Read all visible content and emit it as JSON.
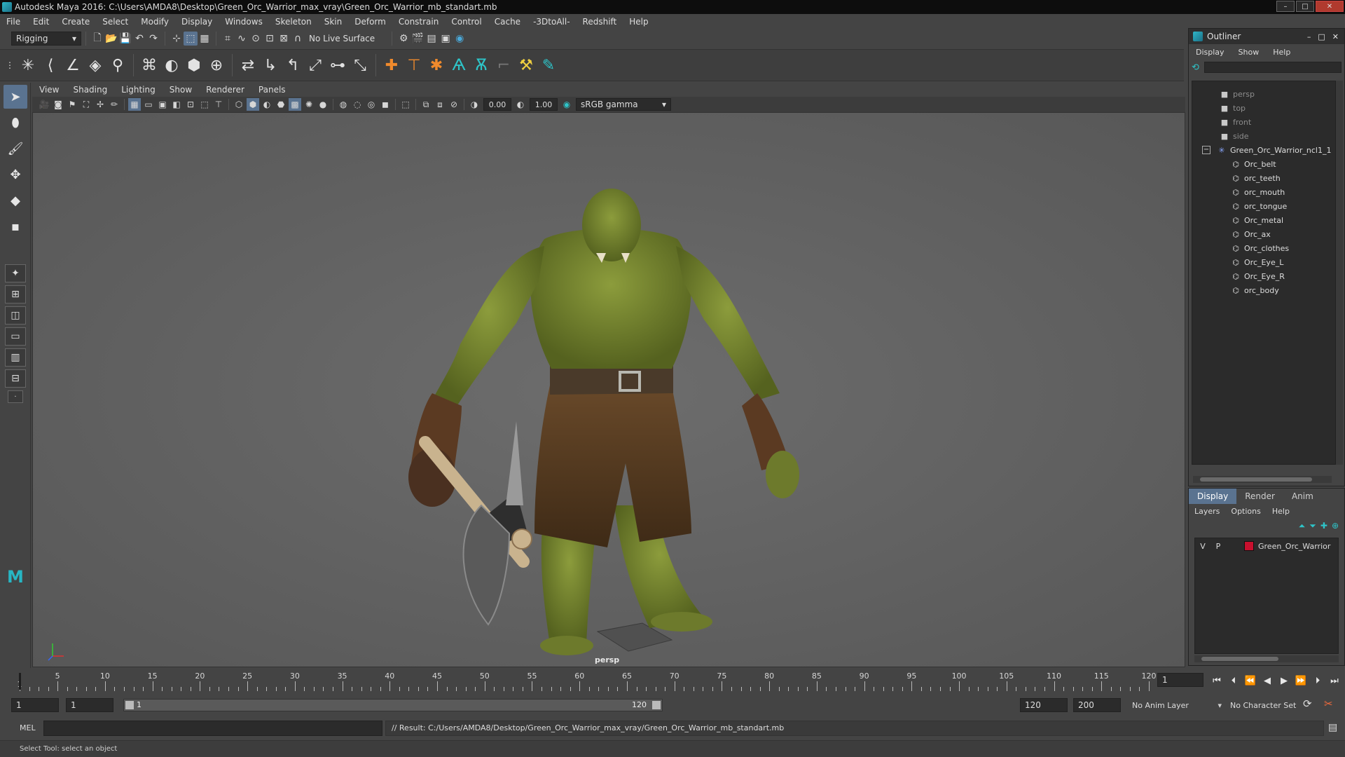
{
  "window": {
    "title": "Autodesk Maya 2016: C:\\Users\\AMDA8\\Desktop\\Green_Orc_Warrior_max_vray\\Green_Orc_Warrior_mb_standart.mb",
    "min": "–",
    "max": "□",
    "close": "✕"
  },
  "menubar": [
    "File",
    "Edit",
    "Create",
    "Select",
    "Modify",
    "Display",
    "Windows",
    "Skeleton",
    "Skin",
    "Deform",
    "Constrain",
    "Control",
    "Cache",
    "-3DtoAll-",
    "Redshift",
    "Help"
  ],
  "statusline": {
    "menuset": "Rigging",
    "live_surface": "No Live Surface"
  },
  "panel": {
    "menus": [
      "View",
      "Shading",
      "Lighting",
      "Show",
      "Renderer",
      "Panels"
    ],
    "exposure": "0.00",
    "gamma": "1.00",
    "colorspace": "sRGB gamma",
    "camera_label": "persp"
  },
  "timeline": {
    "ticks": [
      "5",
      "10",
      "15",
      "20",
      "25",
      "30",
      "35",
      "40",
      "45",
      "50",
      "55",
      "60",
      "65",
      "70",
      "75",
      "80",
      "85",
      "90",
      "95",
      "100",
      "105",
      "110",
      "115",
      "120"
    ],
    "first_label": "1",
    "end_label": "120",
    "current_frame": "1",
    "current_frame_value": 1,
    "min": 1,
    "max": 120
  },
  "range": {
    "start": "1",
    "playback_start": "1",
    "slider_start": "1",
    "slider_end": "120",
    "playback_end": "120",
    "end": "200",
    "anim_layer": "No Anim Layer",
    "character_set": "No Character Set"
  },
  "cmdline": {
    "lang": "MEL",
    "result": "// Result: C:/Users/AMDA8/Desktop/Green_Orc_Warrior_max_vray/Green_Orc_Warrior_mb_standart.mb"
  },
  "helpline": "Select Tool: select an object",
  "outliner": {
    "title": "Outliner",
    "menus": [
      "Display",
      "Show",
      "Help"
    ],
    "cameras": [
      "persp",
      "top",
      "front",
      "side"
    ],
    "group": "Green_Orc_Warrior_ncl1_1",
    "children": [
      "Orc_belt",
      "orc_teeth",
      "orc_mouth",
      "orc_tongue",
      "Orc_metal",
      "Orc_ax",
      "Orc_clothes",
      "Orc_Eye_L",
      "Orc_Eye_R",
      "orc_body"
    ],
    "collapse": "−"
  },
  "layer_editor": {
    "tabs": [
      "Display",
      "Render",
      "Anim"
    ],
    "menus": [
      "Layers",
      "Options",
      "Help"
    ],
    "layer": {
      "v": "V",
      "p": "P",
      "name": "Green_Orc_Warrior",
      "color": "#c8102e"
    }
  }
}
